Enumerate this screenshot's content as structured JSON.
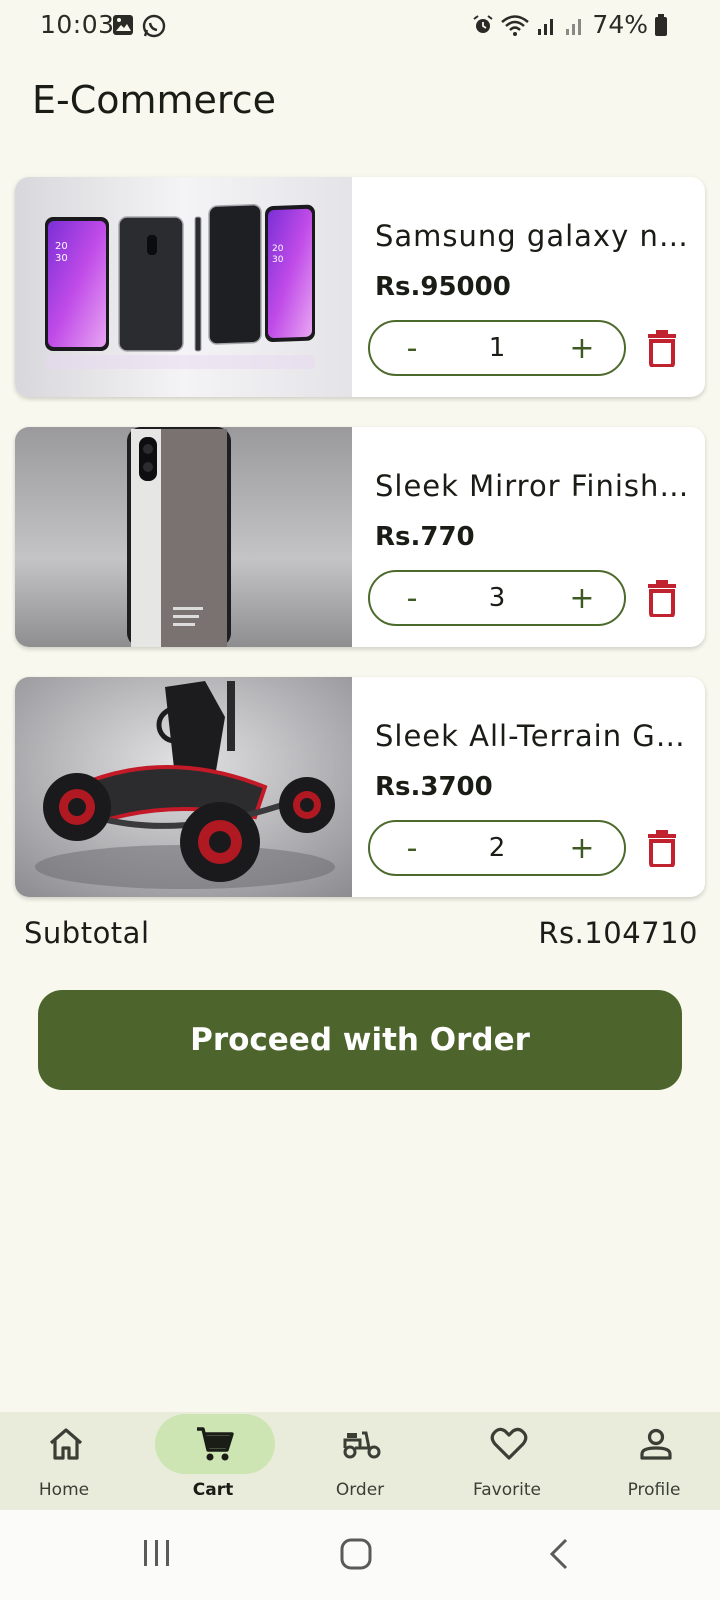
{
  "status_bar": {
    "time": "10:03",
    "battery": "74%"
  },
  "app": {
    "title": "E-Commerce"
  },
  "cart": {
    "items": [
      {
        "name": "Samsung galaxy not...",
        "price": "Rs.95000",
        "quantity": "1",
        "image_icon": "phone-product-image"
      },
      {
        "name": "Sleek Mirror Finish ...",
        "price": "Rs.770",
        "quantity": "3",
        "image_icon": "phone-case-product-image"
      },
      {
        "name": "Sleek All-Terrain Go...",
        "price": "Rs.3700",
        "quantity": "2",
        "image_icon": "go-kart-product-image"
      }
    ],
    "minus_label": "-",
    "plus_label": "+"
  },
  "summary": {
    "subtotal_label": "Subtotal",
    "subtotal_value": "Rs.104710"
  },
  "actions": {
    "proceed_label": "Proceed with Order"
  },
  "bottom_nav": {
    "items": [
      {
        "label": "Home",
        "icon": "home-icon"
      },
      {
        "label": "Cart",
        "icon": "cart-icon"
      },
      {
        "label": "Order",
        "icon": "scooter-icon"
      },
      {
        "label": "Favorite",
        "icon": "heart-icon"
      },
      {
        "label": "Profile",
        "icon": "person-icon"
      }
    ],
    "active": "Cart"
  },
  "colors": {
    "background": "#f8f8ee",
    "accent": "#4d652d",
    "active_pill": "#cde5b3",
    "delete": "#c0222f"
  }
}
